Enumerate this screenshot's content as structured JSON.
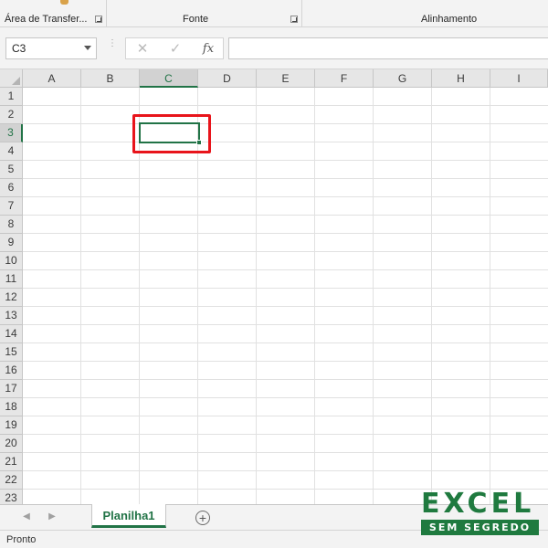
{
  "ribbon": {
    "groups": [
      {
        "label": "Área de Transfer..."
      },
      {
        "label": "Fonte"
      },
      {
        "label": "Alinhamento"
      }
    ]
  },
  "formula_bar": {
    "name_box": "C3",
    "cancel_icon": "✕",
    "enter_icon": "✓",
    "fx_label": "fx",
    "formula_value": ""
  },
  "grid": {
    "columns": [
      "A",
      "B",
      "C",
      "D",
      "E",
      "F",
      "G",
      "H",
      "I"
    ],
    "rows": [
      "1",
      "2",
      "3",
      "4",
      "5",
      "6",
      "7",
      "8",
      "9",
      "10",
      "11",
      "12",
      "13",
      "14",
      "15",
      "16",
      "17",
      "18",
      "19",
      "20",
      "21",
      "22",
      "23"
    ],
    "selected_column": "C",
    "selected_row": "3"
  },
  "sheets": {
    "tabs": [
      "Planilha1"
    ],
    "add_label": "+"
  },
  "status": {
    "text": "Pronto"
  },
  "logo": {
    "top": "EXCEL",
    "bottom": "SEM SEGREDO"
  },
  "colors": {
    "accent": "#217346",
    "highlight": "#e8141b"
  }
}
